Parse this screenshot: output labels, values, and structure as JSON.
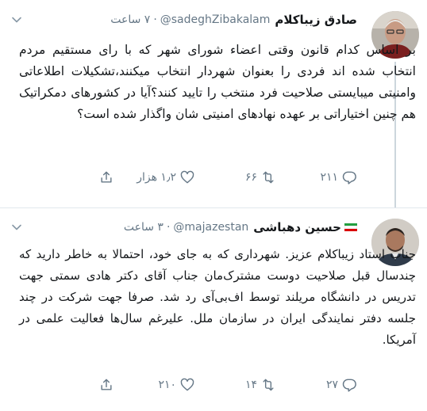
{
  "tweets": [
    {
      "name": "صادق زیباکلام",
      "handle": "@sadeghZibakalam",
      "time": "۷ ساعت",
      "text": "بر اساس کدام قانون وقتی اعضاء شورای شهر که با رای مستقیم مردم انتخاب شده اند فردی را بعنوان شهردار انتخاب میکنند،تشکیلات اطلاعاتی وامنیتی میبایستی صلاحیت فرد منتخب را تایید کنند؟آیا در کشورهای دمکراتیک هم چنین اختیاراتی بر عهده نهادهای امنیتی شان واگذار شده است؟",
      "replies": "۲۱۱",
      "retweets": "۶۶",
      "likes": "۱٫۲ هزار"
    },
    {
      "name": "حسین دهباشی",
      "handle": "@majazestan",
      "time": "۳ ساعت",
      "text": "جناب استاد زیباکلام عزیز. شهرداری که به جای خود،  احتمالا به خاطر دارید که چندسال قبل صلاحیت دوست مشترک‌مان جناب آقای دکتر هادی سمتی جهت تدریس در دانشگاه مریلند توسط اف‌بی‌آی رد شد. صرفا جهت شرکت در چند جلسه دفتر نمایندگی ایران در سازمان ملل. علیرغم سال‌ها فعالیت علمی در آمریکا.",
      "replies": "۲۷",
      "retweets": "۱۴",
      "likes": "۲۱۰"
    }
  ],
  "colors": {
    "text": "#14171a",
    "secondary": "#657786",
    "divider": "#e1e8ed",
    "thread_line": "#ccd6dd",
    "flag_green": "#239f40",
    "flag_white": "#ffffff",
    "flag_red": "#da0000"
  },
  "icons": {
    "reply": "reply-icon",
    "retweet": "retweet-icon",
    "like": "heart-icon",
    "share": "share-icon",
    "caret": "chevron-down-icon",
    "flag": "iran-flag-icon"
  }
}
